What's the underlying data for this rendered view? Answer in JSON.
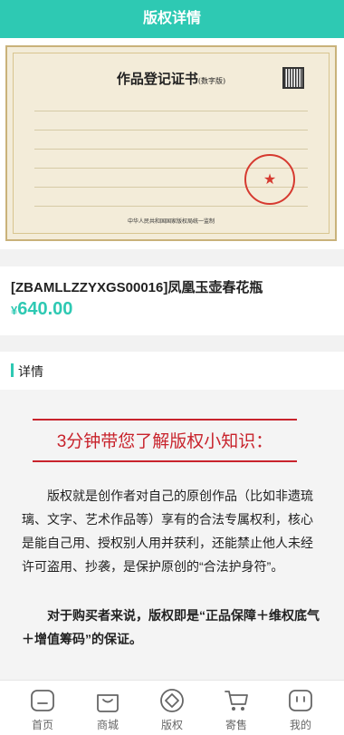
{
  "header": {
    "title": "版权详情"
  },
  "certificate": {
    "title": "作品登记证书",
    "subtitle": "(数字版)",
    "footer": "中华人民共和国国家版权局统一监制"
  },
  "product": {
    "title": "[ZBAMLLZZYXGS00016]凤凰玉壶春花瓶",
    "currency": "¥",
    "price": "640.00"
  },
  "detail": {
    "label": "详情"
  },
  "article": {
    "heading": "3分钟带您了解版权小知识：",
    "paragraph1": "版权就是创作者对自己的原创作品（比如非遗琉璃、文字、艺术作品等）享有的合法专属权利，核心是能自己用、授权别人用并获利，还能禁止他人未经许可盗用、抄袭，是保护原创的“合法护身符”。",
    "paragraph2": "对于购买者来说，版权即是“正品保障＋维权底气＋增值筹码”的保证。"
  },
  "tabbar": {
    "items": [
      {
        "label": "首页",
        "icon": "home-icon"
      },
      {
        "label": "商城",
        "icon": "shopping-bag-icon"
      },
      {
        "label": "版权",
        "icon": "copyright-diamond-icon"
      },
      {
        "label": "寄售",
        "icon": "cart-icon"
      },
      {
        "label": "我的",
        "icon": "profile-icon"
      }
    ],
    "active_color": "#2ec9b3"
  },
  "colors": {
    "accent": "#2ec9b3",
    "article_red": "#c8232c"
  }
}
